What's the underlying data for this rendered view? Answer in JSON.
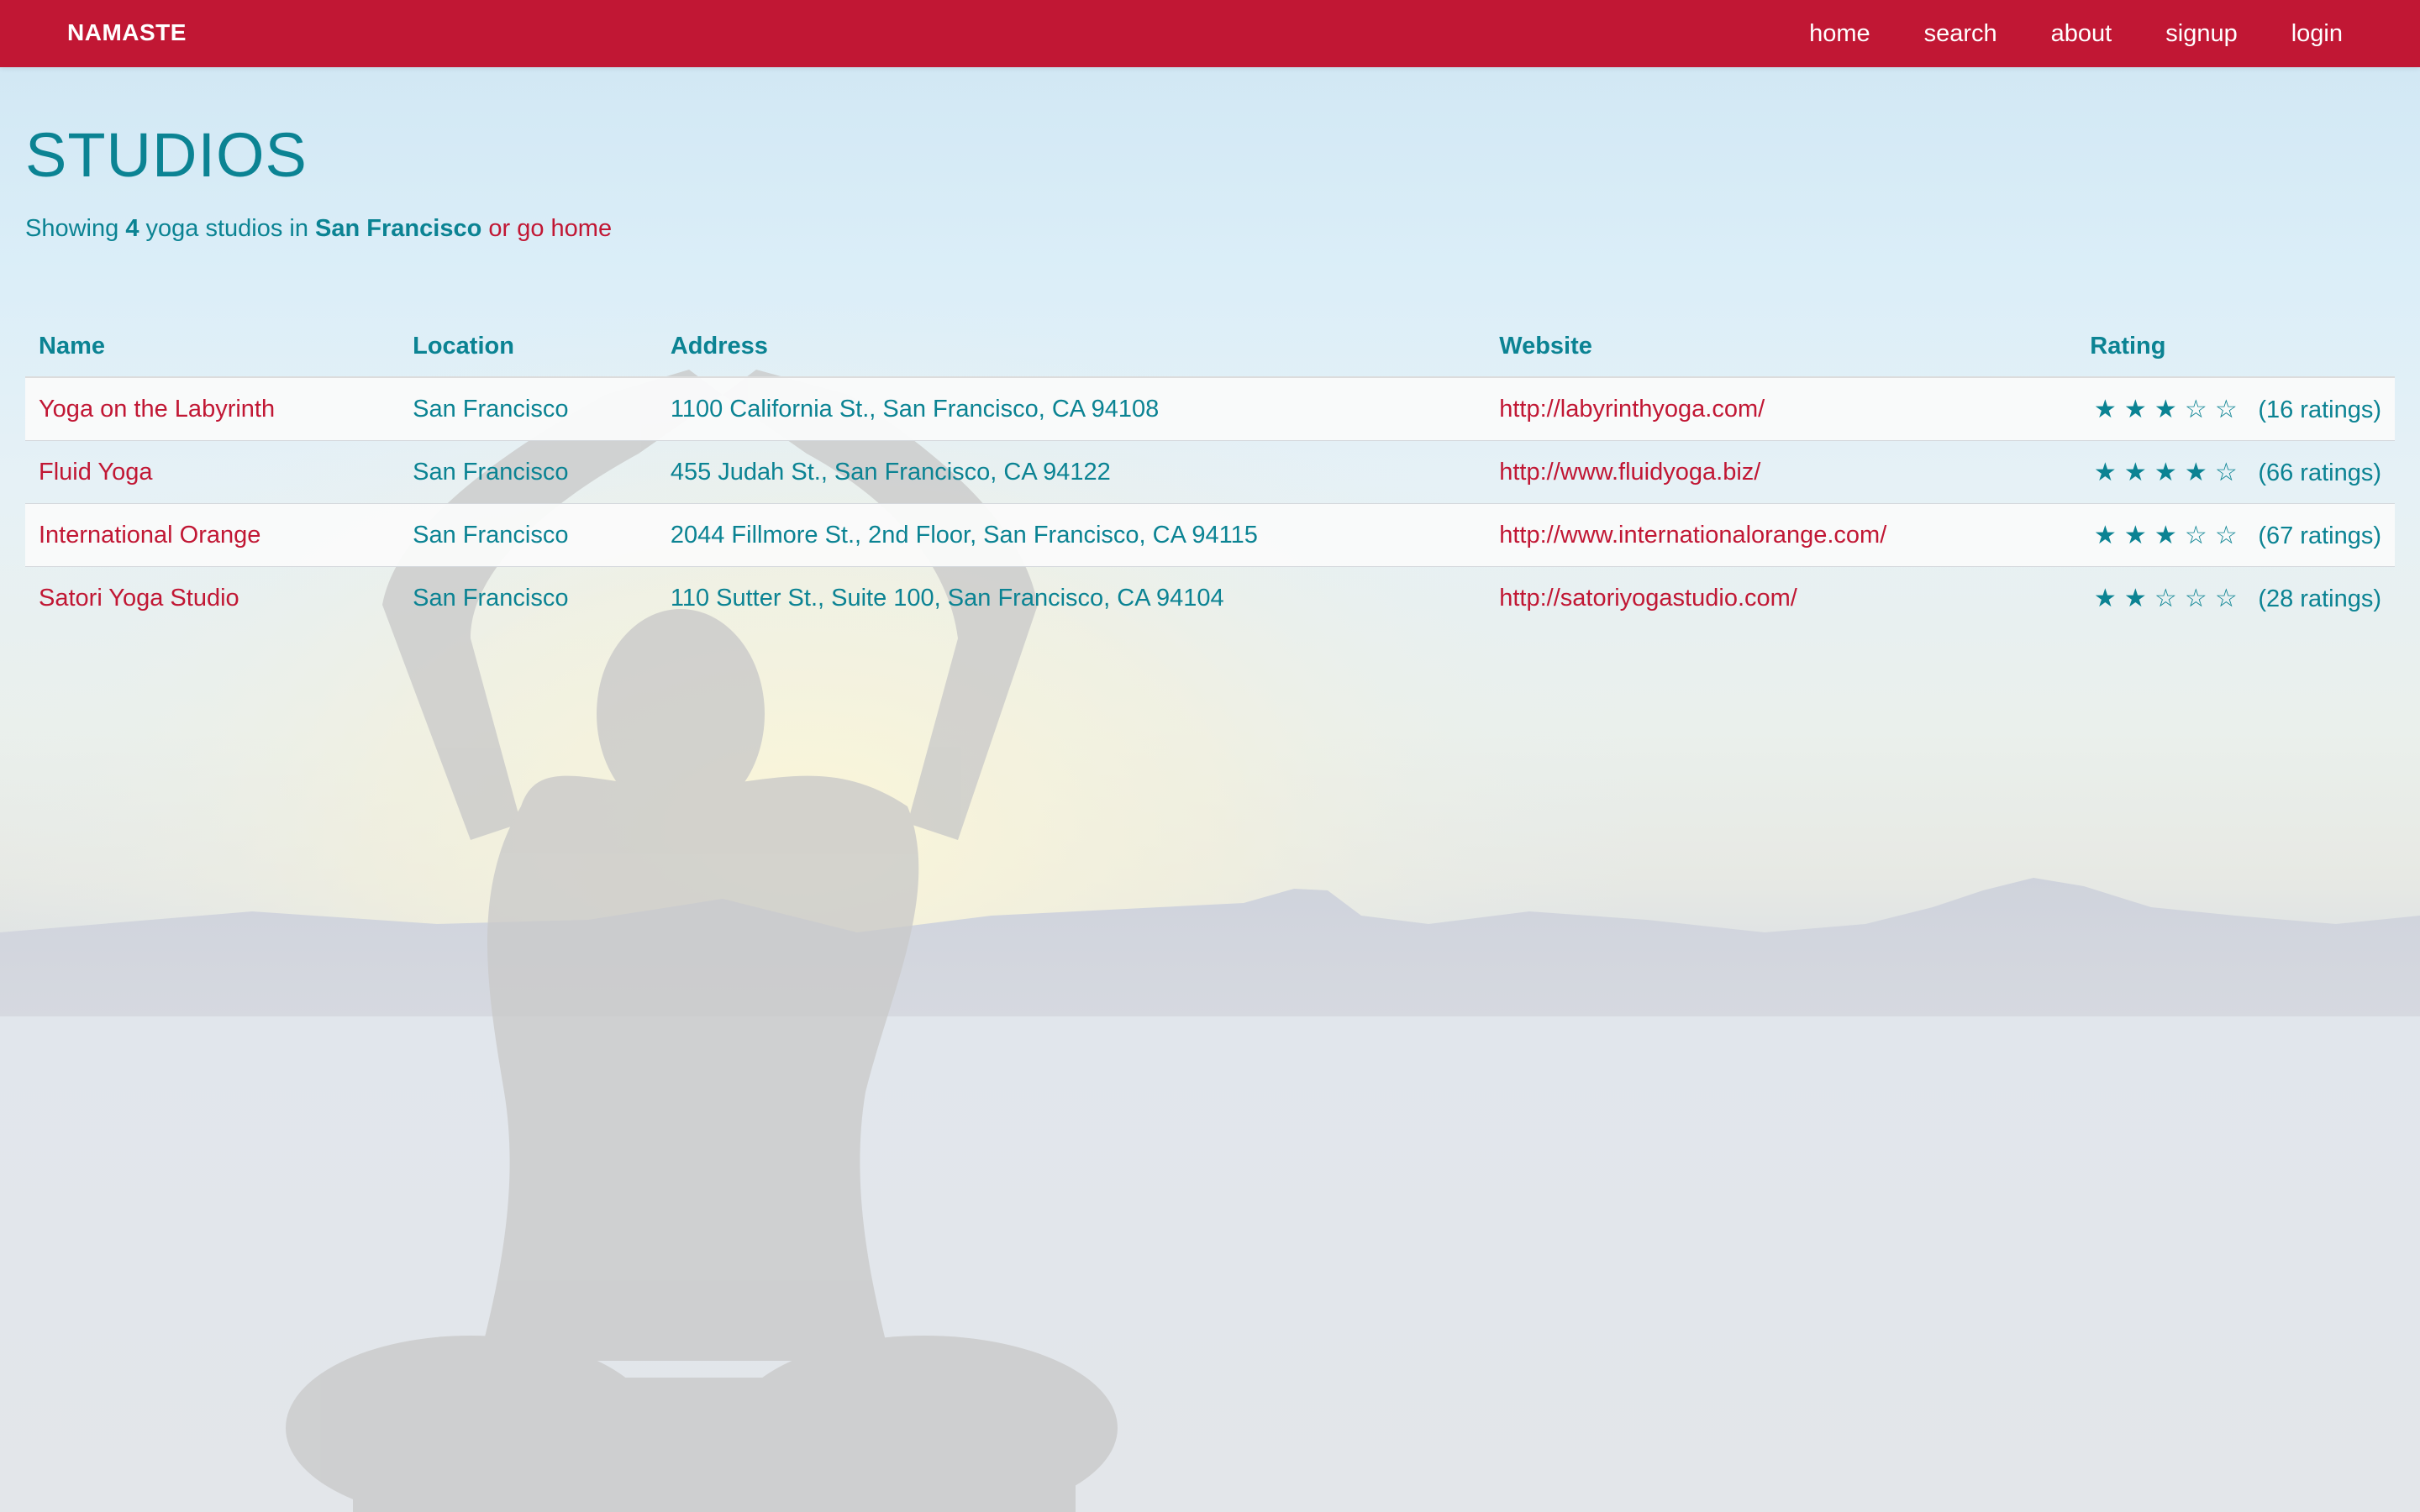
{
  "nav": {
    "brand": "NAMASTE",
    "links": [
      "home",
      "search",
      "about",
      "signup",
      "login"
    ]
  },
  "page": {
    "title": "STUDIOS",
    "summary": {
      "prefix": "Showing",
      "count": "4",
      "mid": "yoga studios in",
      "city": "San Francisco",
      "or": "or",
      "home_link": "go home"
    }
  },
  "table": {
    "headers": [
      "Name",
      "Location",
      "Address",
      "Website",
      "Rating"
    ],
    "rows": [
      {
        "name": "Yoga on the Labyrinth",
        "location": "San Francisco",
        "address": "1100 California St., San Francisco, CA 94108",
        "website": "http://labyrinthyoga.com/",
        "stars": 3,
        "ratings": "(16 ratings)"
      },
      {
        "name": "Fluid Yoga",
        "location": "San Francisco",
        "address": "455 Judah St., San Francisco, CA 94122",
        "website": "http://www.fluidyoga.biz/",
        "stars": 4,
        "ratings": "(66 ratings)"
      },
      {
        "name": "International Orange",
        "location": "San Francisco",
        "address": "2044 Fillmore St., 2nd Floor, San Francisco, CA 94115",
        "website": "http://www.internationalorange.com/",
        "stars": 3,
        "ratings": "(67 ratings)"
      },
      {
        "name": "Satori Yoga Studio",
        "location": "San Francisco",
        "address": "110 Sutter St., Suite 100, San Francisco, CA 94104",
        "website": "http://satoriyogastudio.com/",
        "stars": 2,
        "ratings": "(28 ratings)"
      }
    ],
    "max_stars": 5
  },
  "colors": {
    "brand_red": "#c11734",
    "teal": "#0b8393",
    "row_stripe": "#fafafa"
  },
  "icons": {
    "star_filled": "star-filled-icon",
    "star_empty": "star-empty-icon"
  }
}
